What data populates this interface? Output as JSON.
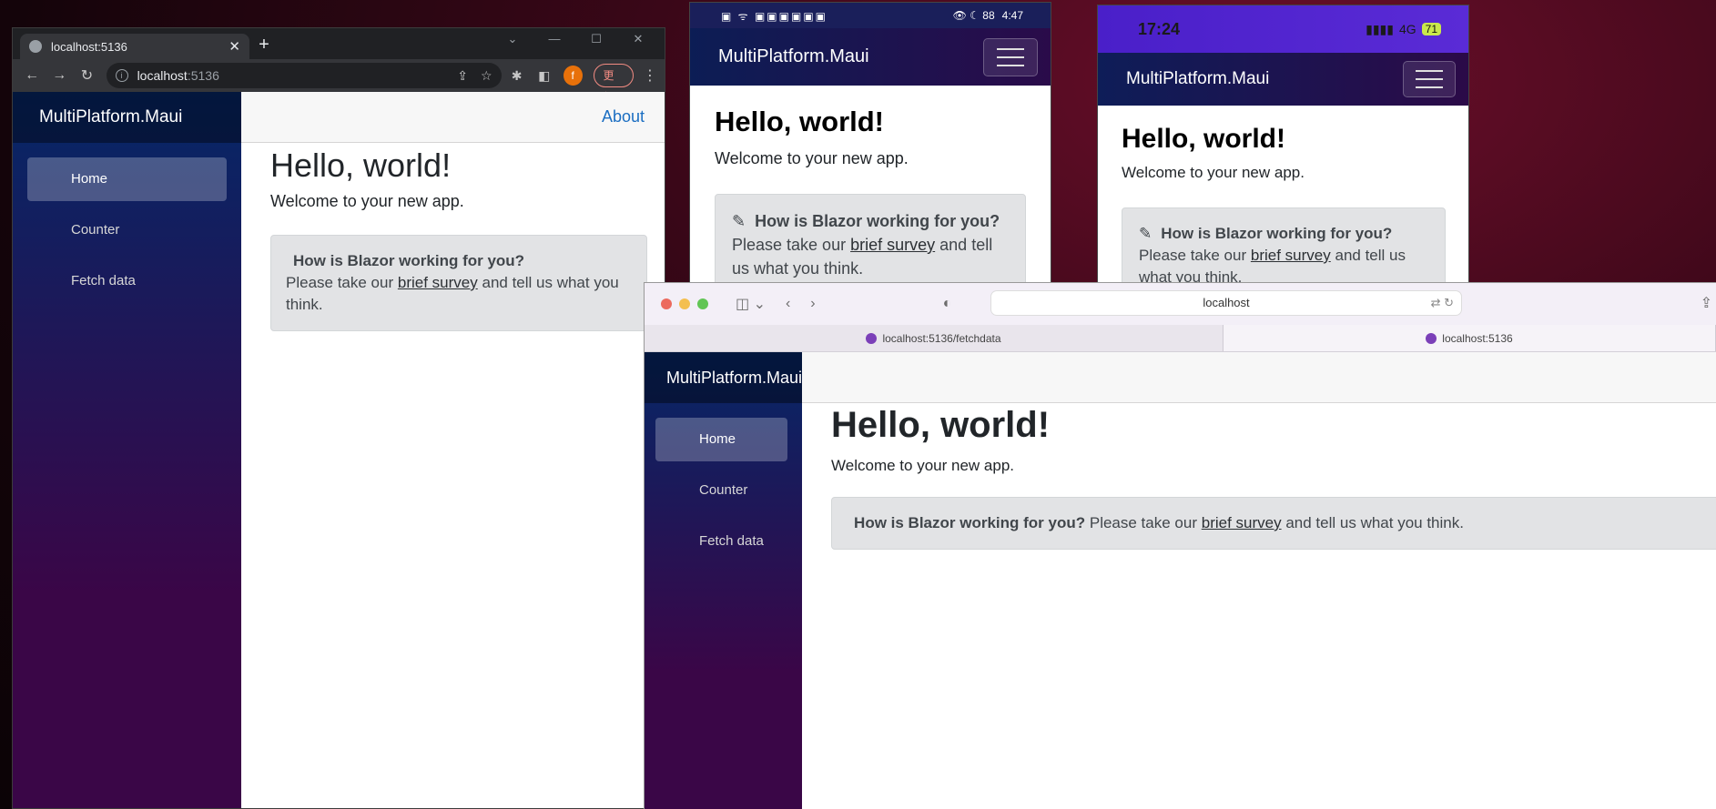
{
  "chrome": {
    "tab_title": "localhost:5136",
    "close_glyph": "✕",
    "newtab_glyph": "+",
    "window_controls": [
      "⌄",
      "—",
      "☐",
      "✕"
    ],
    "address_host": "localhost",
    "address_port": ":5136",
    "update_label": "更新",
    "avatar_letter": "f"
  },
  "app": {
    "brand": "MultiPlatform.Maui",
    "nav": {
      "home": "Home",
      "counter": "Counter",
      "fetch": "Fetch data"
    },
    "about": "About",
    "heading": "Hello, world!",
    "welcome": "Welcome to your new app.",
    "alert": {
      "question": "How is Blazor working for you?",
      "prefix": "Please take our",
      "link": "brief survey",
      "suffix": "and tell us what you think."
    }
  },
  "phone1": {
    "status_time": "4:47",
    "status_left_icons": "▣ ᯤ ▣▣▣▣▣▣",
    "status_right_icons": "👁 ☾ 88"
  },
  "phone2": {
    "status_time": "17:24",
    "network": "4G",
    "battery": "71"
  },
  "safari": {
    "address": "localhost",
    "tabs": [
      {
        "label": "localhost:5136/fetchdata"
      },
      {
        "label": "localhost:5136"
      }
    ]
  }
}
